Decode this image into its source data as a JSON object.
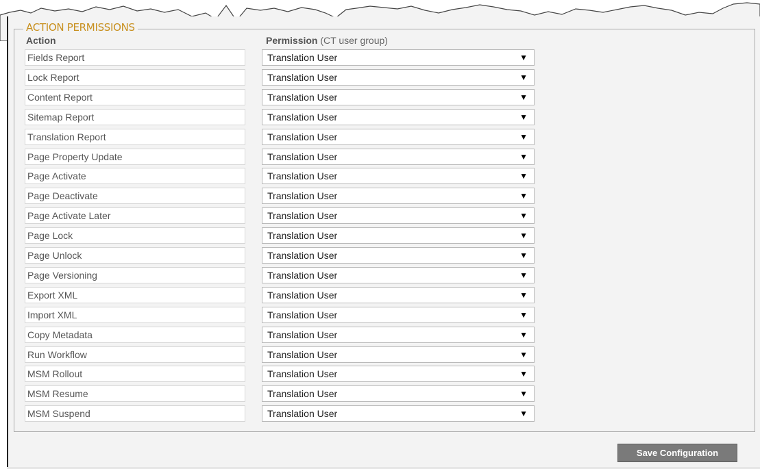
{
  "legend": "ACTION PERMISSIONS",
  "headers": {
    "action": "Action",
    "permission": "Permission",
    "permission_sub": "(CT user group)"
  },
  "rows": [
    {
      "action": "Fields Report",
      "permission": "Translation User"
    },
    {
      "action": "Lock Report",
      "permission": "Translation User"
    },
    {
      "action": "Content Report",
      "permission": "Translation User"
    },
    {
      "action": "Sitemap Report",
      "permission": "Translation User"
    },
    {
      "action": "Translation Report",
      "permission": "Translation User"
    },
    {
      "action": "Page Property Update",
      "permission": "Translation User"
    },
    {
      "action": "Page Activate",
      "permission": "Translation User"
    },
    {
      "action": "Page Deactivate",
      "permission": "Translation User"
    },
    {
      "action": "Page Activate Later",
      "permission": "Translation User"
    },
    {
      "action": "Page Lock",
      "permission": "Translation User"
    },
    {
      "action": "Page Unlock",
      "permission": "Translation User"
    },
    {
      "action": "Page Versioning",
      "permission": "Translation User"
    },
    {
      "action": "Export XML",
      "permission": "Translation User"
    },
    {
      "action": "Import XML",
      "permission": "Translation User"
    },
    {
      "action": "Copy Metadata",
      "permission": "Translation User"
    },
    {
      "action": "Run Workflow",
      "permission": "Translation User"
    },
    {
      "action": "MSM Rollout",
      "permission": "Translation User"
    },
    {
      "action": "MSM Resume",
      "permission": "Translation User"
    },
    {
      "action": "MSM Suspend",
      "permission": "Translation User"
    }
  ],
  "dropdown_arrow": "▼",
  "save_button": "Save Configuration",
  "colors": {
    "legend": "#c8901f",
    "panel_bg": "#f3f3f3",
    "button_bg": "#7a7a7a"
  }
}
